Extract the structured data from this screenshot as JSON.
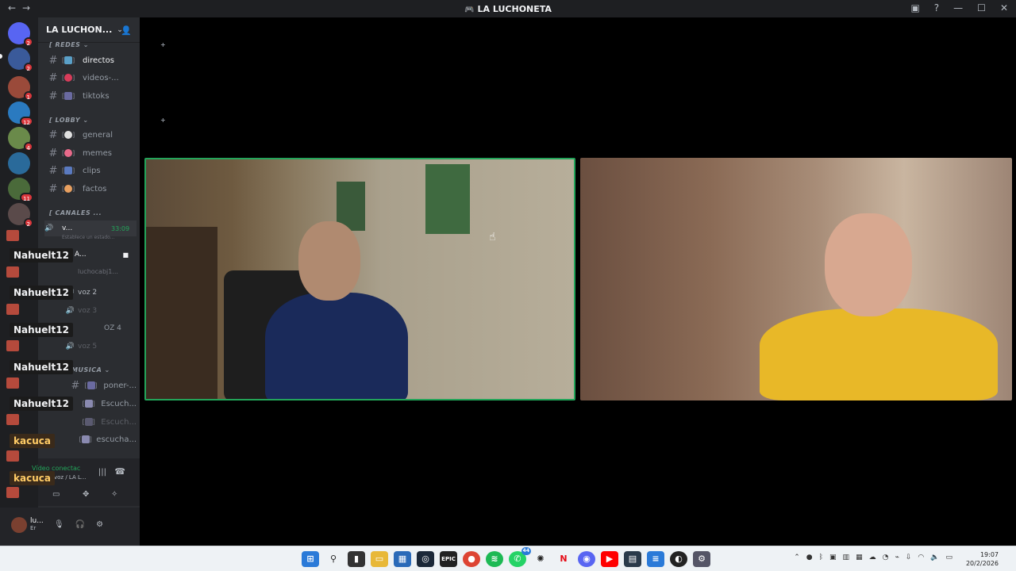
{
  "window": {
    "title": "LA LUCHONETA",
    "controls": [
      "notification-icon",
      "help-icon",
      "minimize",
      "maximize",
      "close"
    ]
  },
  "guild": {
    "name": "LA LUCHON...",
    "invite_icon": "add-member-icon"
  },
  "server_badges": [
    "2",
    "2",
    "1",
    "12",
    "4",
    "11",
    "2"
  ],
  "categories": {
    "redes": "REDES",
    "lobby": "LOBBY",
    "canales": "CANALES ...",
    "musica": "MUSICA"
  },
  "channels": {
    "directos": "directos",
    "videos": "videos-...",
    "tiktoks": "tiktoks",
    "general": "general",
    "memes": "memes",
    "clips": "clips",
    "factos": "factos",
    "voz_active": "v...",
    "voz_time": "33:09",
    "status_placeholder": "Establece un estado...",
    "voz_a": "A...",
    "lucho_user": "luchocabj1...",
    "voz2": "voz 2",
    "voz3": "voz 3",
    "voz4": "OZ 4",
    "voz5": "voz 5",
    "poner": "poner-...",
    "escuch1": "Escuch...",
    "escuch2": "Escuch...",
    "escucha": "escucha..."
  },
  "overlay_tags": [
    "Nahuelt12",
    "Nahuelt12",
    "Nahuelt12",
    "Nahuelt12",
    "Nahuelt12",
    "kacuca",
    "kacuca"
  ],
  "voice_panel": {
    "status": "Vídeo conectac",
    "location": "voz / LA L..."
  },
  "user_panel": {
    "name": "lu...",
    "sub": "Er"
  },
  "taskbar": {
    "time": "19:07",
    "date": "20/2/2026",
    "chat_badge": "44"
  }
}
